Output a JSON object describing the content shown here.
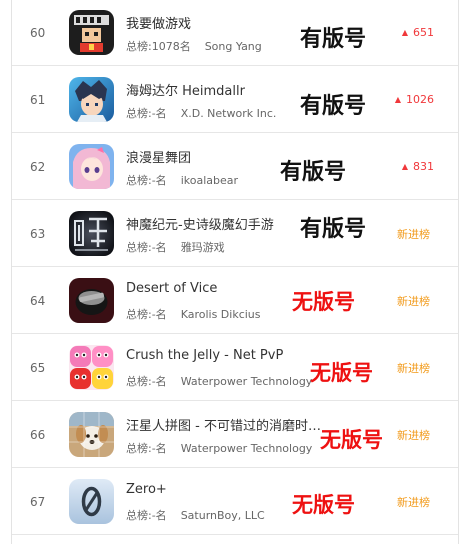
{
  "rows": [
    {
      "rank": "60",
      "name": "我要做游戏",
      "chart_rank": "总榜:1078名",
      "developer": "Song Yang",
      "stamp": "有版号",
      "change_arrow": "▲",
      "change": "651",
      "icon": "game-dev-pixel-icon"
    },
    {
      "rank": "61",
      "name": "海姆达尔 Heimdallr",
      "chart_rank": "总榜:-名",
      "developer": "X.D. Network Inc.",
      "stamp": "有版号",
      "change_arrow": "▲",
      "change": "1026",
      "icon": "anime-boy-icon"
    },
    {
      "rank": "62",
      "name": "浪漫星舞团",
      "chart_rank": "总榜:-名",
      "developer": "ikoalabear",
      "stamp": "有版号",
      "change_arrow": "▲",
      "change": "831",
      "icon": "anime-girl-icon"
    },
    {
      "rank": "63",
      "name": "神魔纪元-史诗级魔幻手游",
      "chart_rank": "总榜:-名",
      "developer": "雅玛游戏",
      "stamp": "有版号",
      "change_arrow": "",
      "change": "新进榜",
      "icon": "shenmo-logo-icon"
    },
    {
      "rank": "64",
      "name": "Desert of Vice",
      "chart_rank": "总榜:-名",
      "developer": "Karolis Dikcius",
      "stamp": "无版号",
      "change_arrow": "",
      "change": "新进榜",
      "icon": "dark-pot-icon"
    },
    {
      "rank": "65",
      "name": "Crush the Jelly - Net PvP",
      "chart_rank": "总榜:-名",
      "developer": "Waterpower Technology",
      "stamp": "无版号",
      "change_arrow": "",
      "change": "新进榜",
      "icon": "jelly-faces-icon"
    },
    {
      "rank": "66",
      "name": "汪星人拼图 - 不可错过的消磨时间的游戏",
      "chart_rank": "总榜:-名",
      "developer": "Waterpower Technology",
      "stamp": "无版号",
      "change_arrow": "",
      "change": "新进榜",
      "icon": "puppy-puzzle-icon"
    },
    {
      "rank": "67",
      "name": "Zero+",
      "chart_rank": "总榜:-名",
      "developer": "SaturnBoy, LLC",
      "stamp": "无版号",
      "change_arrow": "",
      "change": "新进榜",
      "icon": "zero-digit-icon"
    }
  ]
}
